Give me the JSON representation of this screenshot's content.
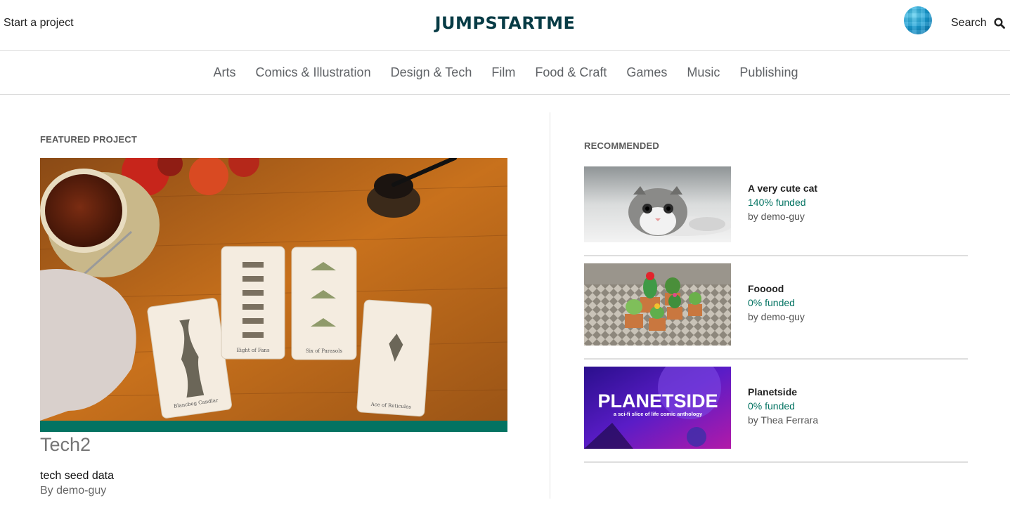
{
  "header": {
    "start_project": "Start a project",
    "logo": "JUMPSTARTME",
    "search_label": "Search",
    "search_icon": "magnifier-icon"
  },
  "categories": [
    "Arts",
    "Comics & Illustration",
    "Design & Tech",
    "Film",
    "Food & Craft",
    "Games",
    "Music",
    "Publishing"
  ],
  "featured": {
    "section_label": "FEATURED PROJECT",
    "title": "Tech2",
    "blurb": "tech seed data",
    "author": "By demo-guy",
    "funded_fraction": 1.0,
    "card_captions": [
      "Blancbeg Candlar",
      "Eight of Fans",
      "Six of Parasols",
      "Ace of Reticules"
    ]
  },
  "recommended": {
    "section_label": "RECOMMENDED",
    "items": [
      {
        "title": "A very cute cat",
        "funded": "140% funded",
        "by": "by demo-guy"
      },
      {
        "title": "Fooood",
        "funded": "0% funded",
        "by": "by demo-guy"
      },
      {
        "title": "Planetside",
        "funded": "0% funded",
        "by": "by Thea Ferrara",
        "art_title": "PLANETSIDE",
        "art_subtitle": "a sci-fi slice of life comic anthology"
      }
    ]
  },
  "colors": {
    "accent": "#037362",
    "logo": "#073b45",
    "nav_text": "#5f6266"
  }
}
